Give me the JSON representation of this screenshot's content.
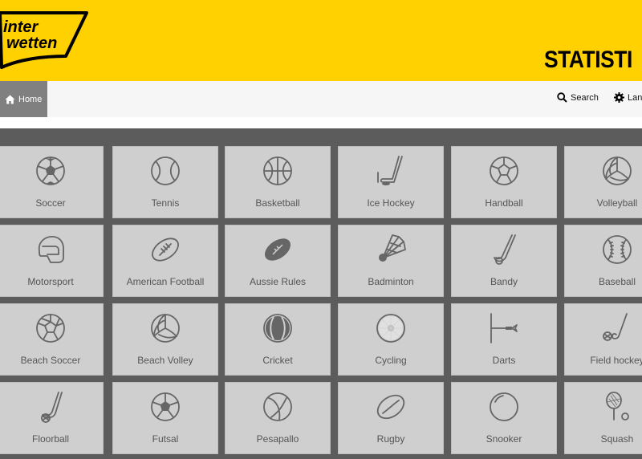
{
  "brand": {
    "line1": "inter",
    "line2": "wetten"
  },
  "header": {
    "title": "STATISTI"
  },
  "nav": {
    "home_label": "Home",
    "search_label": "Search",
    "language_label": "Lan"
  },
  "sports": [
    {
      "label": "Soccer",
      "icon": "soccer-ball-icon"
    },
    {
      "label": "Tennis",
      "icon": "tennis-ball-icon"
    },
    {
      "label": "Basketball",
      "icon": "basketball-icon"
    },
    {
      "label": "Ice Hockey",
      "icon": "ice-hockey-icon"
    },
    {
      "label": "Handball",
      "icon": "handball-icon"
    },
    {
      "label": "Volleyball",
      "icon": "volleyball-icon"
    },
    {
      "label": "Motorsport",
      "icon": "helmet-icon"
    },
    {
      "label": "American Football",
      "icon": "american-football-icon"
    },
    {
      "label": "Aussie Rules",
      "icon": "aussie-rules-ball-icon"
    },
    {
      "label": "Badminton",
      "icon": "shuttlecock-icon"
    },
    {
      "label": "Bandy",
      "icon": "bandy-stick-icon"
    },
    {
      "label": "Baseball",
      "icon": "baseball-icon"
    },
    {
      "label": "Beach Soccer",
      "icon": "beach-soccer-icon"
    },
    {
      "label": "Beach Volley",
      "icon": "beach-volley-icon"
    },
    {
      "label": "Cricket",
      "icon": "cricket-ball-icon"
    },
    {
      "label": "Cycling",
      "icon": "cycling-wheel-icon"
    },
    {
      "label": "Darts",
      "icon": "dart-icon"
    },
    {
      "label": "Field hockey",
      "icon": "field-hockey-icon"
    },
    {
      "label": "Floorball",
      "icon": "floorball-icon"
    },
    {
      "label": "Futsal",
      "icon": "futsal-ball-icon"
    },
    {
      "label": "Pesapallo",
      "icon": "pesapallo-ball-icon"
    },
    {
      "label": "Rugby",
      "icon": "rugby-ball-icon"
    },
    {
      "label": "Snooker",
      "icon": "snooker-ball-icon"
    },
    {
      "label": "Squash",
      "icon": "squash-racket-icon"
    }
  ],
  "colors": {
    "brand_yellow": "#ffd100",
    "nav_active": "#808080",
    "tile_bg": "#cfcfcf",
    "grid_bg": "#5c5c5c",
    "icon_stroke": "#666666"
  }
}
